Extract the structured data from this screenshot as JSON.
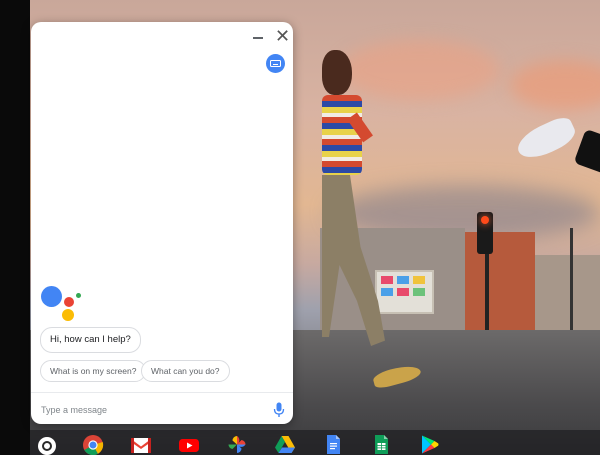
{
  "assistant": {
    "greeting": "Hi, how can I help?",
    "suggestions": [
      "What is on my screen?",
      "What can you do?"
    ],
    "input_placeholder": "Type a message",
    "close_glyph": "✕"
  },
  "shelf": {
    "apps": [
      "launcher-icon",
      "chrome-icon",
      "gmail-icon",
      "youtube-icon",
      "photos-icon",
      "drive-icon",
      "docs-icon",
      "sheets-icon",
      "play-store-icon"
    ]
  },
  "colors": {
    "google_blue": "#4285f4",
    "google_red": "#ea4335",
    "google_yellow": "#fbbc05",
    "google_green": "#34a853"
  }
}
